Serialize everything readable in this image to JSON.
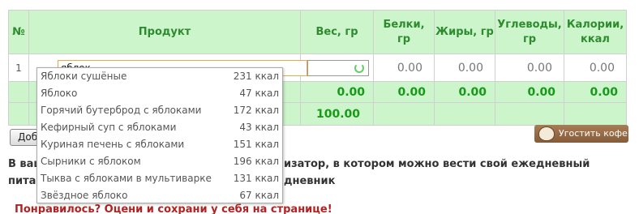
{
  "table": {
    "headers": {
      "num": "№",
      "product": "Продукт",
      "weight": "Вес, гр",
      "protein_1": "Белки,",
      "protein_2": "гр",
      "fat": "Жиры, гр",
      "carbs_1": "Углеводы,",
      "carbs_2": "гр",
      "calories_1": "Калории,",
      "calories_2": "ккал"
    },
    "row": {
      "num": "1",
      "product_value": "яблок",
      "protein": "0.00",
      "fat": "0.00",
      "carbs": "0.00",
      "calories": "0.00"
    },
    "totals": {
      "weight": "0.00",
      "protein": "0.00",
      "fat": "0.00",
      "carbs": "0.00",
      "calories": "0.00"
    },
    "total_weight": "100.00"
  },
  "autocomplete": [
    {
      "name": "Яблоки сушёные",
      "kcal": "231 ккал"
    },
    {
      "name": "Яблоко",
      "kcal": "47 ккал"
    },
    {
      "name": "Горячий бутерброд с яблоками",
      "kcal": "172 ккал"
    },
    {
      "name": "Кефирный суп с яблоками",
      "kcal": "43 ккал"
    },
    {
      "name": "Куриная печень с яблоками",
      "kcal": "151 ккал"
    },
    {
      "name": "Сырники с яблоком",
      "kcal": "196 ккал"
    },
    {
      "name": "Тыква с яблоками в мультиварке",
      "kcal": "131 ккал"
    },
    {
      "name": "Звёздное яблоко",
      "kcal": "67 ккал"
    }
  ],
  "add_button": "Доб",
  "coffee_button": "Угостить кофе",
  "description": {
    "line1_left": "В ваш",
    "line1_right": "изатор, в котором можно вести свой ежедневный дневник",
    "line2": "питан"
  },
  "like_text": "Понравилось? Оцени и сохрани у себя на странице!"
}
